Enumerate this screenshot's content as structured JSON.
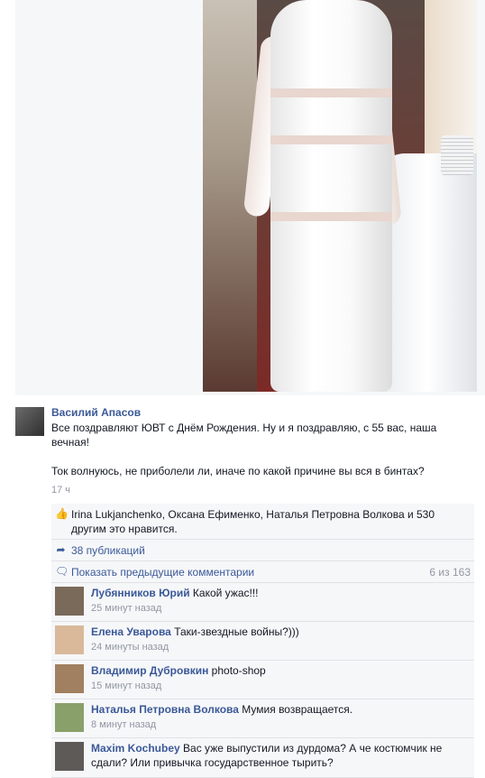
{
  "post": {
    "author": "Василий Апасов",
    "text": "Все поздравляют ЮВТ с Днём Рождения. Ну и я поздравляю, с 55 вас, наша вечная!\n\nТок волнуюсь, не приболели ли, иначе по какой причине вы вся в бинтах?",
    "time": "17 ч"
  },
  "ufi": {
    "likes_text": "Irina Lukjanchenko, Оксана Ефименко, Наталья Петровна Волкова и 530 другим это нравится.",
    "shares_text": "38 публикаций",
    "prev_comments_label": "Показать предыдущие комментарии",
    "comments_count": "6 из 163",
    "like_icon": "thumbs-up-icon",
    "share_icon": "share-arrow-icon",
    "comment_icon": "speech-bubble-icon"
  },
  "comments": [
    {
      "name": "Лубянников Юрий",
      "text": "Какой ужас!!!",
      "time": "25 минут назад"
    },
    {
      "name": "Елена Уварова",
      "text": "Таки-звездные войны?)))",
      "time": "24 минуты назад"
    },
    {
      "name": "Владимир Дубровкин",
      "text": "photo-shop",
      "time": "15 минут назад"
    },
    {
      "name": "Наталья Петровна Волкова",
      "text": "Мумия возвращается.",
      "time": "8 минут назад"
    },
    {
      "name": "Maxim Kochubey",
      "text": "Вас уже выпустили из дурдома? А че костюмчик не сдали? Или привычка государственное тырить?",
      "time": ""
    }
  ],
  "colors": {
    "link": "#3b5998",
    "meta": "#9197a3",
    "ufi_bg": "#f6f7f9"
  }
}
